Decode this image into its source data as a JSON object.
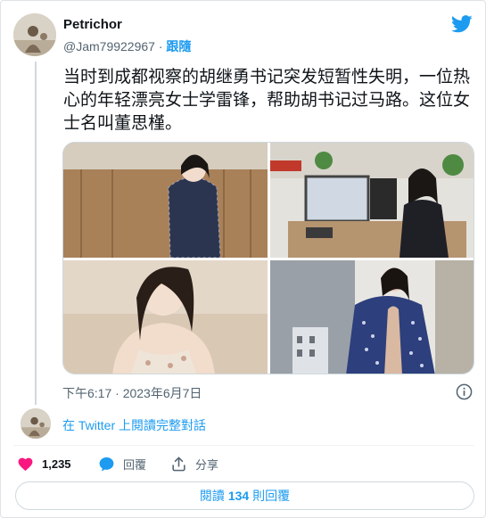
{
  "author": {
    "display_name": "Petrichor",
    "handle": "@Jam79922967",
    "separator": "·",
    "follow_label": "跟隨"
  },
  "tweet": {
    "text": "当时到成都视察的胡继勇书记突发短暂性失明，一位热心的年轻漂亮女士学雷锋，帮助胡书记过马路。这位女士名叫董思槿。",
    "timestamp": "下午6:17 · 2023年6月7日"
  },
  "thread": {
    "read_link": "在 Twitter 上閱讀完整對話"
  },
  "actions": {
    "like_count": "1,235",
    "reply_label": "回覆",
    "share_label": "分享"
  },
  "footer": {
    "read_prefix": "閱讀",
    "reply_count": "134",
    "read_suffix": "則回覆"
  },
  "colors": {
    "accent": "#1d9bf0",
    "like": "#f91880",
    "text": "#0f1419",
    "muted": "#536471"
  },
  "icons": [
    "twitter-bird-icon",
    "info-icon",
    "heart-icon",
    "reply-bubble-icon",
    "share-icon"
  ]
}
